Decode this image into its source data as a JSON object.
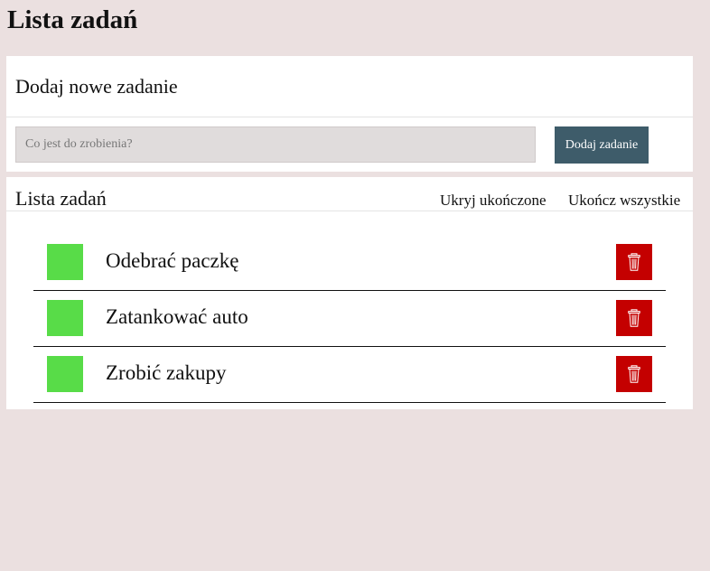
{
  "page": {
    "title": "Lista zadań"
  },
  "add_form": {
    "title": "Dodaj nowe zadanie",
    "input_placeholder": "Co jest do zrobienia?",
    "input_value": "",
    "submit_label": "Dodaj zadanie"
  },
  "task_list": {
    "title": "Lista zadań",
    "hide_completed_label": "Ukryj ukończone",
    "complete_all_label": "Ukończ wszystkie",
    "items": [
      {
        "label": "Odebrać paczkę",
        "checkbox_color": "#58dc48",
        "delete_icon": "trash-icon"
      },
      {
        "label": "Zatankować auto",
        "checkbox_color": "#58dc48",
        "delete_icon": "trash-icon"
      },
      {
        "label": "Zrobić zakupy",
        "checkbox_color": "#58dc48",
        "delete_icon": "trash-icon"
      }
    ]
  },
  "colors": {
    "background": "#ebe0e0",
    "panel": "#ffffff",
    "submit_button": "#3e5c6a",
    "checkbox": "#58dc48",
    "delete_button": "#c40000"
  }
}
